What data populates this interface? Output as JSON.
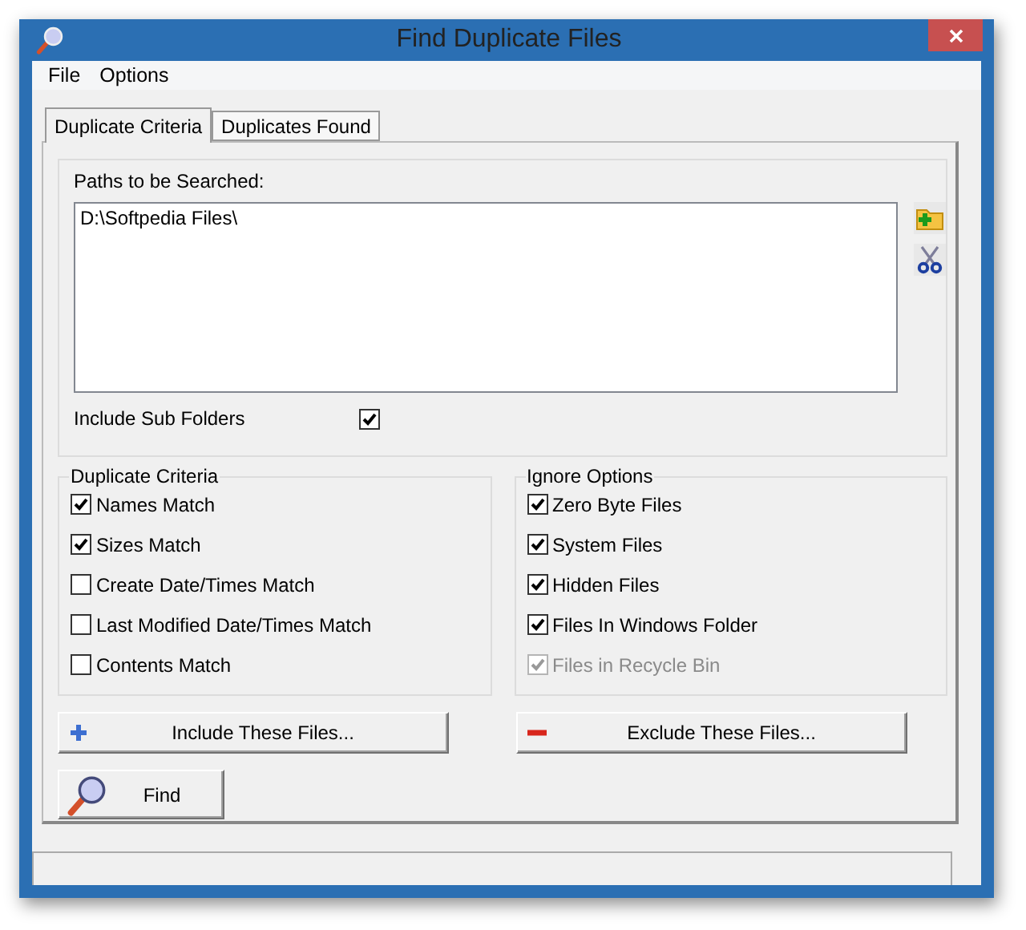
{
  "window": {
    "title": "Find Duplicate Files"
  },
  "menu": [
    "File",
    "Options"
  ],
  "tabs": [
    {
      "label": "Duplicate Criteria",
      "selected": true
    },
    {
      "label": "Duplicates Found",
      "selected": false
    }
  ],
  "paths": {
    "label": "Paths to be Searched:",
    "items": [
      "D:\\Softpedia Files\\"
    ]
  },
  "include_sub_folders": {
    "label": "Include Sub Folders",
    "checked": true
  },
  "duplicate_criteria": {
    "title": "Duplicate Criteria",
    "options": [
      {
        "label": "Names Match",
        "checked": true,
        "disabled": false
      },
      {
        "label": "Sizes Match",
        "checked": true,
        "disabled": false
      },
      {
        "label": "Create Date/Times Match",
        "checked": false,
        "disabled": false
      },
      {
        "label": "Last Modified Date/Times Match",
        "checked": false,
        "disabled": false
      },
      {
        "label": "Contents Match",
        "checked": false,
        "disabled": false
      }
    ]
  },
  "ignore_options": {
    "title": "Ignore Options",
    "options": [
      {
        "label": "Zero Byte Files",
        "checked": true,
        "disabled": false
      },
      {
        "label": "System Files",
        "checked": true,
        "disabled": false
      },
      {
        "label": "Hidden Files",
        "checked": true,
        "disabled": false
      },
      {
        "label": "Files In Windows Folder",
        "checked": true,
        "disabled": false
      },
      {
        "label": "Files in Recycle Bin",
        "checked": true,
        "disabled": true
      }
    ]
  },
  "buttons": [
    {
      "kind": "include",
      "label": "Include These Files..."
    },
    {
      "kind": "exclude",
      "label": "Exclude These Files..."
    }
  ],
  "find_button": {
    "label": "Find"
  }
}
